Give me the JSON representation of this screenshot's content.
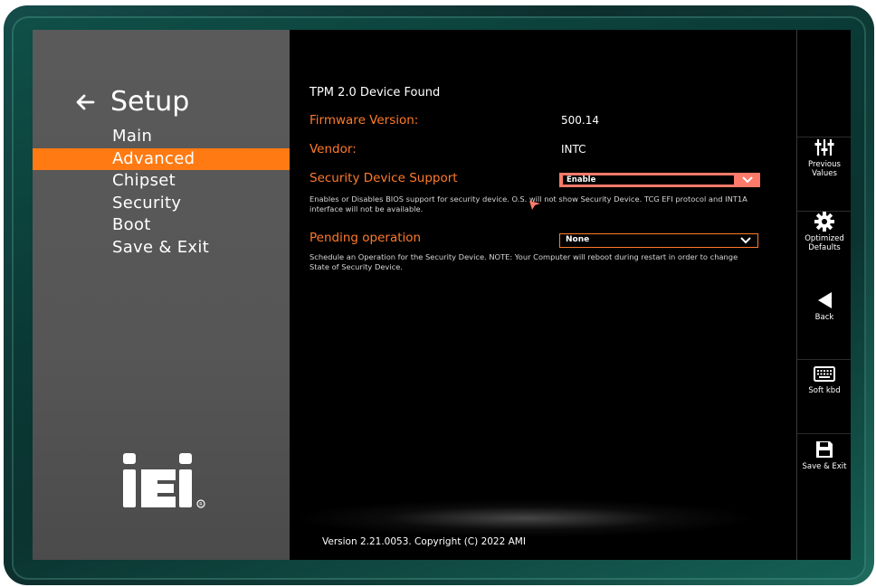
{
  "sidebar": {
    "title": "Setup",
    "items": [
      {
        "label": "Main",
        "active": false
      },
      {
        "label": "Advanced",
        "active": true
      },
      {
        "label": "Chipset",
        "active": false
      },
      {
        "label": "Security",
        "active": false
      },
      {
        "label": "Boot",
        "active": false
      },
      {
        "label": "Save & Exit",
        "active": false
      }
    ],
    "logo_text": "iEi"
  },
  "main": {
    "heading": "TPM 2.0 Device Found",
    "firmware_label": "Firmware Version:",
    "firmware_value": "500.14",
    "vendor_label": "Vendor:",
    "vendor_value": "INTC",
    "security_support_label": "Security Device Support",
    "security_support_value": "Enable",
    "security_support_help": "Enables or Disables BIOS support for security device. O.S. will not show Security Device. TCG EFI protocol and INT1A interface will not be available.",
    "pending_label": "Pending operation",
    "pending_value": "None",
    "pending_help": "Schedule an Operation for the Security Device. NOTE: Your Computer will reboot during restart in order to change State of Security Device.",
    "version": "Version 2.21.0053. Copyright (C) 2022 AMI"
  },
  "right_bar": {
    "buttons": [
      {
        "label_line1": "Previous",
        "label_line2": "Values",
        "icon": "sliders-icon"
      },
      {
        "label_line1": "Optimized",
        "label_line2": "Defaults",
        "icon": "gear-icon"
      },
      {
        "label_line1": "Back",
        "label_line2": "",
        "icon": "triangle-left-icon"
      },
      {
        "label_line1": "Soft kbd",
        "label_line2": "",
        "icon": "keyboard-icon"
      },
      {
        "label_line1": "Save & Exit",
        "label_line2": "",
        "icon": "floppy-icon"
      }
    ]
  },
  "colors": {
    "accent": "#ff7a12",
    "label_orange": "#ff7a2a",
    "sidebar_bg": "#565656",
    "bezel": "#0f5048"
  }
}
